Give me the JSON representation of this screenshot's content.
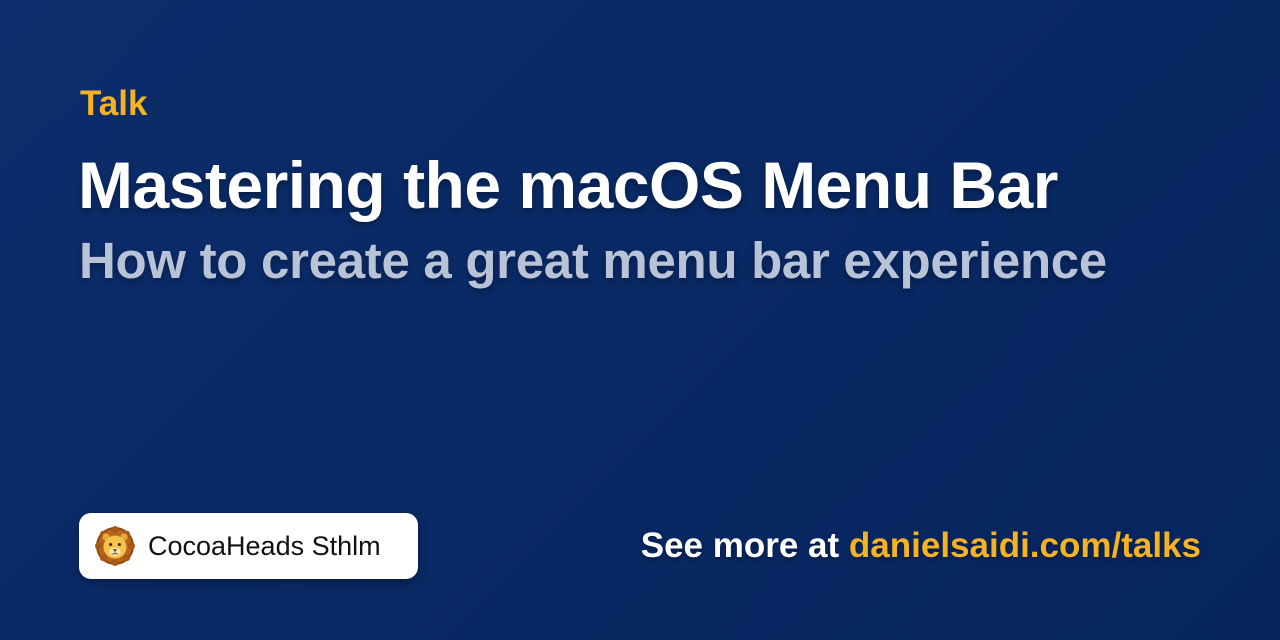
{
  "talk": {
    "eyebrow": "Talk",
    "title": "Mastering the macOS Menu Bar",
    "subtitle": "How to create a great menu bar experience"
  },
  "badge": {
    "logo_icon": "lion-face-icon",
    "label": "CocoaHeads Sthlm"
  },
  "footer": {
    "prefix": "See more at ",
    "link": "danielsaidi.com/talks"
  },
  "colors": {
    "background_top": "#0c2d6b",
    "background_bottom": "#06255e",
    "accent": "#f5b324",
    "title": "#ffffff",
    "subtitle": "#b9c3d7"
  }
}
